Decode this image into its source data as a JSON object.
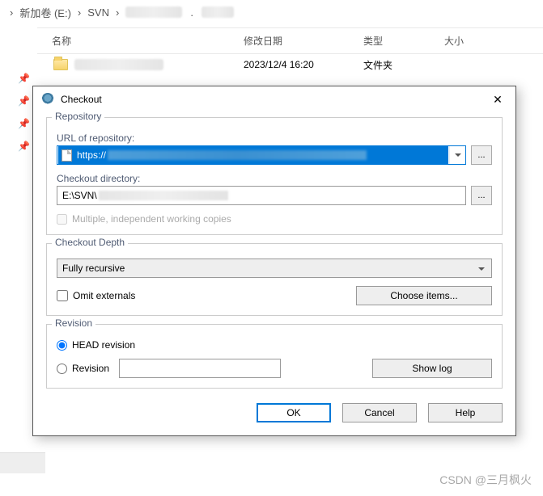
{
  "breadcrumb": {
    "seg1": "新加卷 (E:)",
    "seg2": "SVN"
  },
  "file_list": {
    "headers": {
      "name": "名称",
      "date": "修改日期",
      "type": "类型",
      "size": "大小"
    },
    "row": {
      "date": "2023/12/4 16:20",
      "type": "文件夹"
    }
  },
  "dialog": {
    "title": "Checkout",
    "repo": {
      "legend": "Repository",
      "url_label": "URL of repository:",
      "url_prefix": "https://",
      "dir_label": "Checkout directory:",
      "dir_value": "E:\\SVN\\",
      "multi_label": "Multiple, independent working copies",
      "browse": "..."
    },
    "depth": {
      "legend": "Checkout Depth",
      "value": "Fully recursive",
      "omit_label": "Omit externals",
      "choose_label": "Choose items..."
    },
    "rev": {
      "legend": "Revision",
      "head": "HEAD revision",
      "rev": "Revision",
      "showlog": "Show log"
    },
    "buttons": {
      "ok": "OK",
      "cancel": "Cancel",
      "help": "Help"
    }
  },
  "watermark": "CSDN @三月枫火"
}
